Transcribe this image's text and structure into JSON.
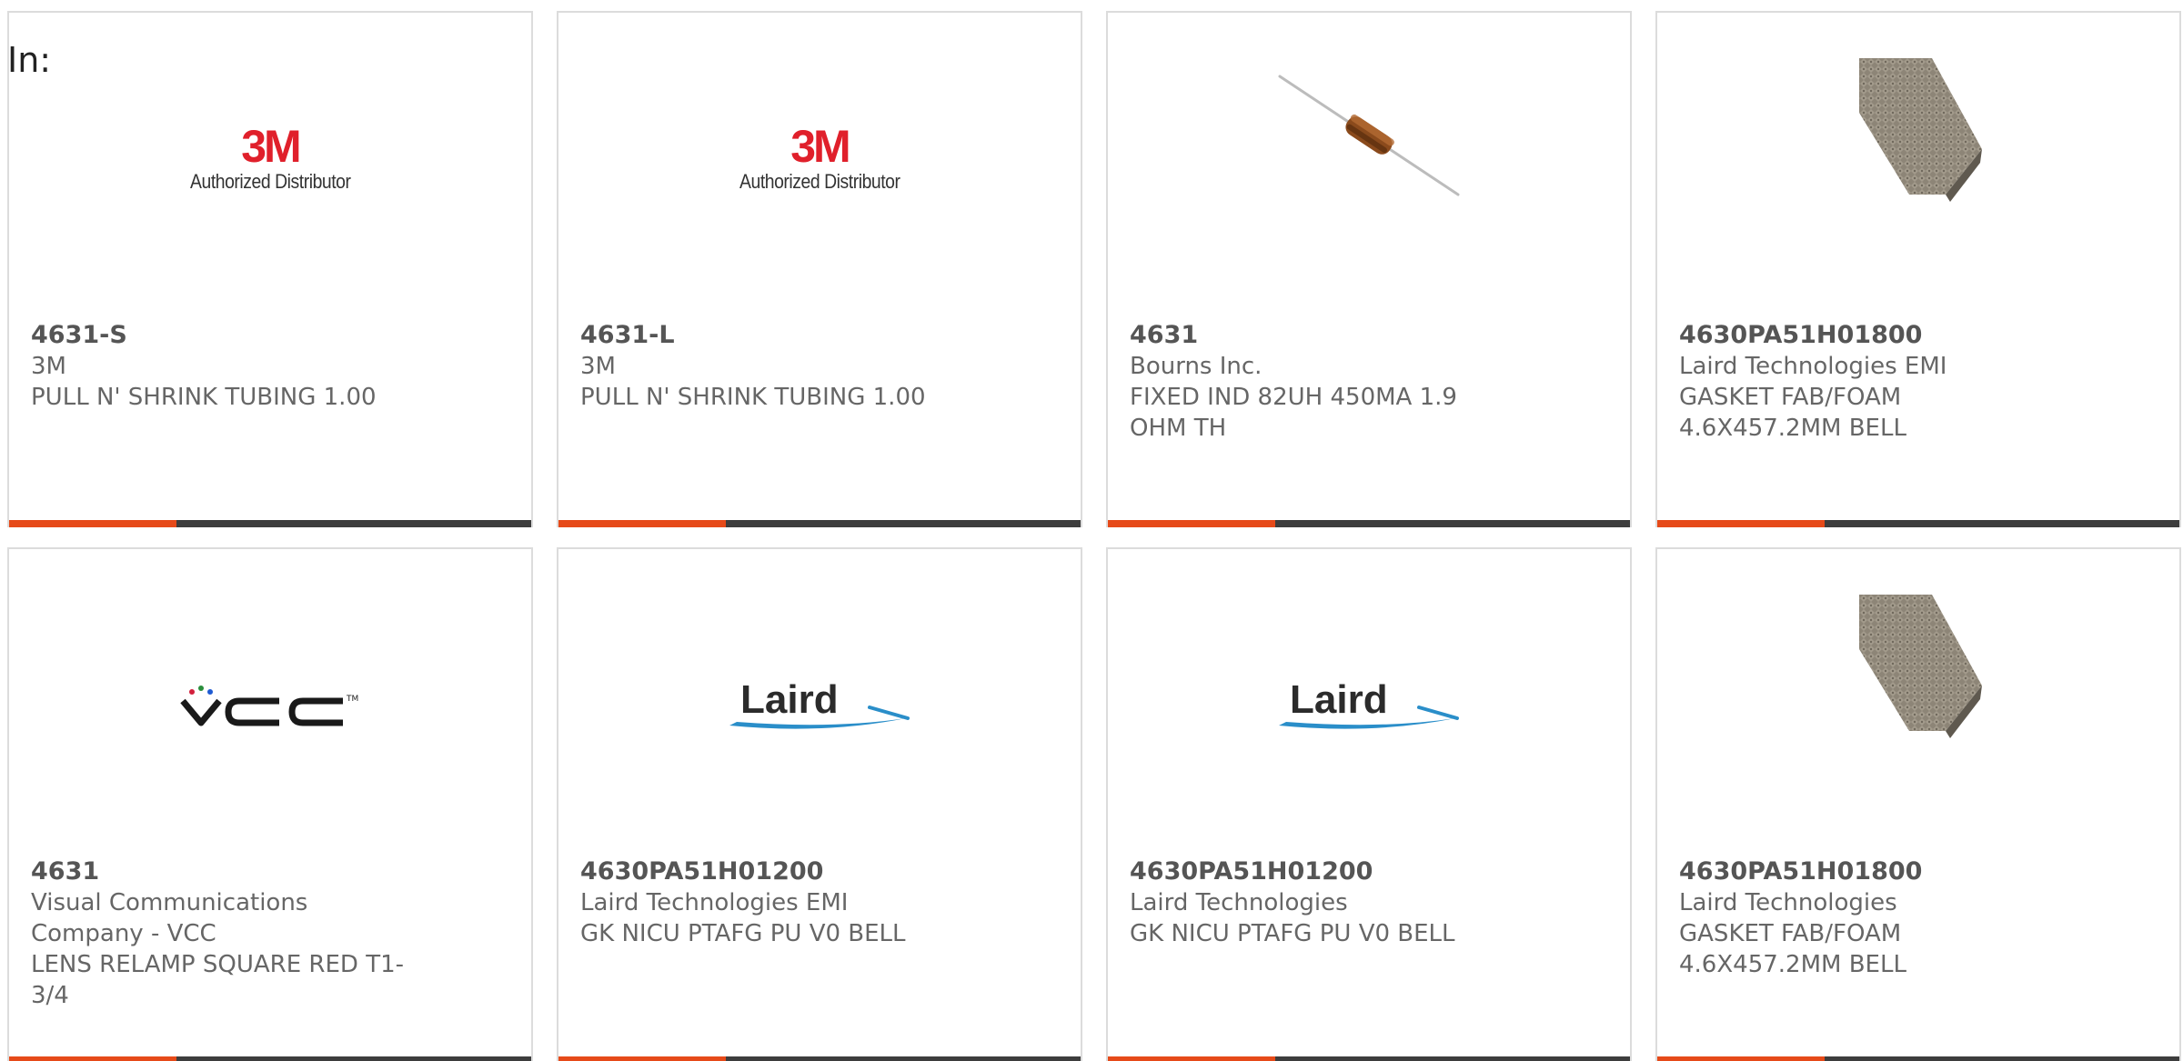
{
  "filter_label": "In:",
  "colors": {
    "accent": "#e64a19",
    "bar": "#3d3d3d",
    "brand_3m": "#e0202b",
    "laird_blue": "#2a8ec9"
  },
  "products": [
    {
      "part_number": "4631-S",
      "manufacturer": "3M",
      "description": "PULL N' SHRINK TUBING 1.00",
      "image": "3m-logo",
      "logo_mark": "3M",
      "logo_sub": "Authorized Distributor"
    },
    {
      "part_number": "4631-L",
      "manufacturer": "3M",
      "description": "PULL N' SHRINK TUBING 1.00",
      "image": "3m-logo",
      "logo_mark": "3M",
      "logo_sub": "Authorized Distributor"
    },
    {
      "part_number": "4631",
      "manufacturer": "Bourns Inc.",
      "description": "FIXED IND 82UH 450MA 1.9 OHM TH",
      "image": "inductor-photo"
    },
    {
      "part_number": "4630PA51H01800",
      "manufacturer": "Laird Technologies EMI",
      "description": "GASKET FAB/FOAM 4.6X457.2MM BELL",
      "image": "gasket-photo"
    },
    {
      "part_number": "4631",
      "manufacturer": "Visual Communications Company - VCC",
      "description": "LENS RELAMP SQUARE RED T1-3/4",
      "image": "vcc-logo",
      "logo_mark": "VCC"
    },
    {
      "part_number": "4630PA51H01200",
      "manufacturer": "Laird Technologies EMI",
      "description": "GK NICU PTAFG PU V0 BELL",
      "image": "laird-logo",
      "logo_mark": "Laird"
    },
    {
      "part_number": "4630PA51H01200",
      "manufacturer": "Laird Technologies",
      "description": "GK NICU PTAFG PU V0 BELL",
      "image": "laird-logo",
      "logo_mark": "Laird"
    },
    {
      "part_number": "4630PA51H01800",
      "manufacturer": "Laird Technologies",
      "description": "GASKET FAB/FOAM 4.6X457.2MM BELL",
      "image": "gasket-photo"
    }
  ]
}
